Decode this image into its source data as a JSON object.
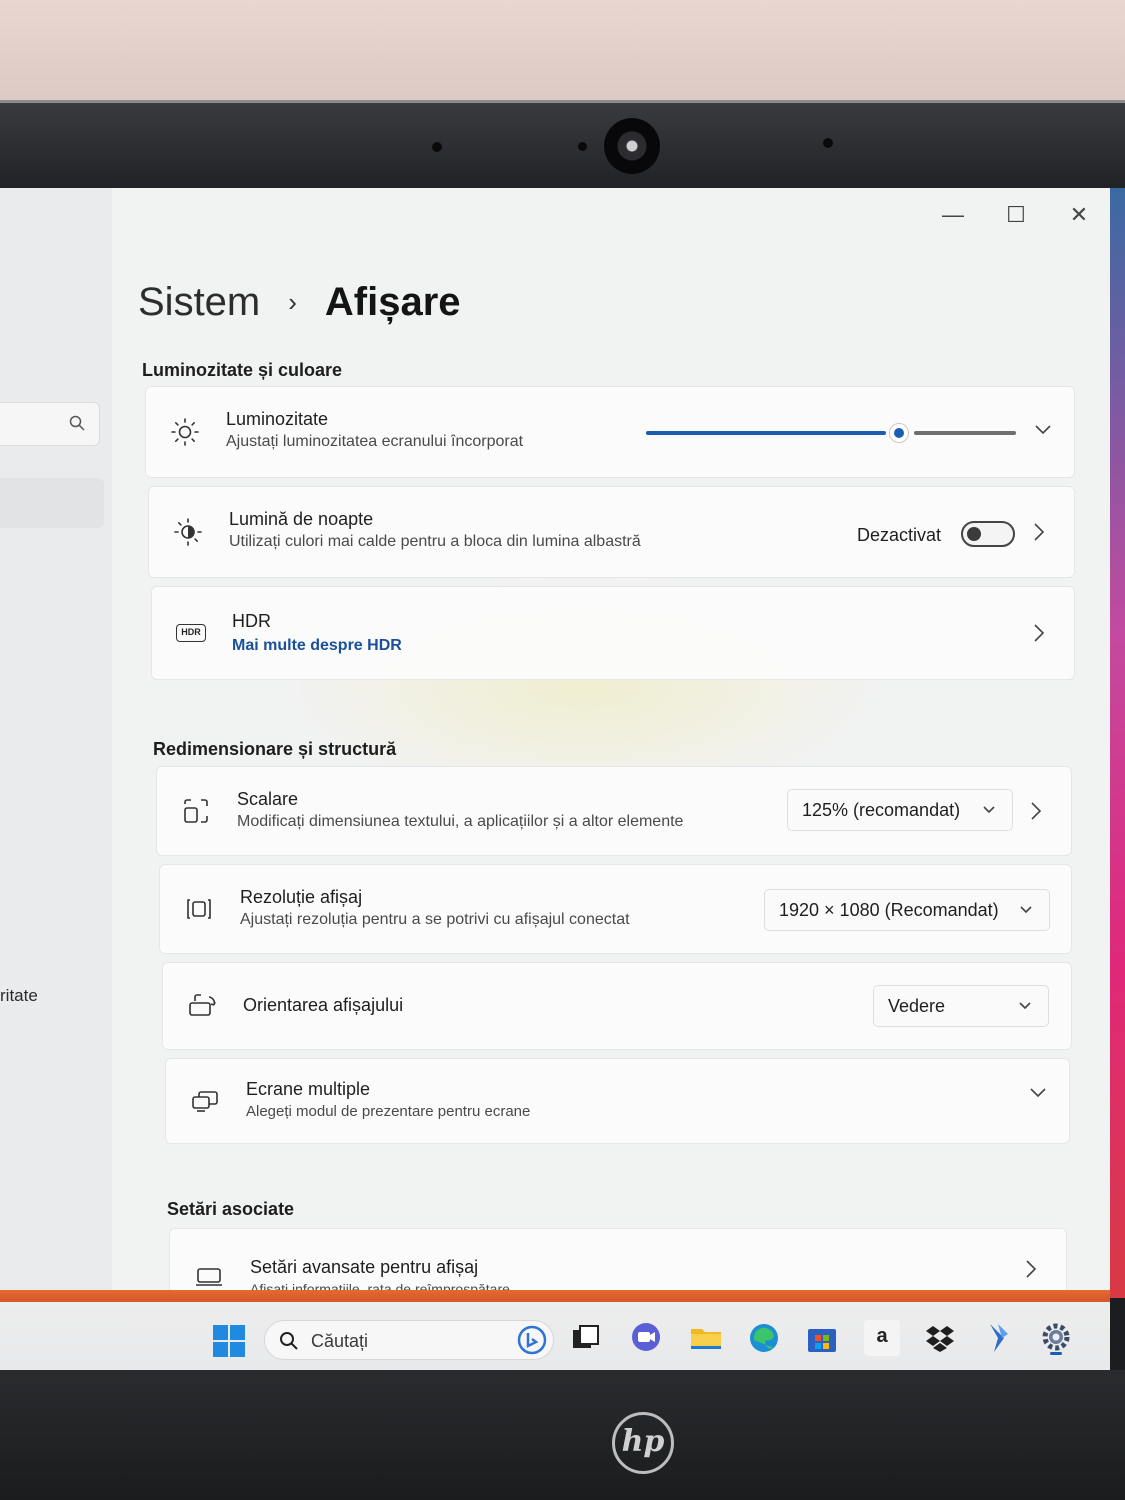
{
  "window": {
    "minimize_glyph": "—",
    "maximize_glyph": "☐",
    "close_glyph": "✕"
  },
  "breadcrumb": {
    "parent": "Sistem",
    "separator": "›",
    "current": "Afișare"
  },
  "sidebar": {
    "partial_item_text": "ritate"
  },
  "sections": {
    "brightness_color": "Luminozitate și culoare",
    "scale_layout": "Redimensionare și structură",
    "related": "Setări asociate"
  },
  "brightness": {
    "title": "Luminozitate",
    "subtitle": "Ajustați luminozitatea ecranului încorporat",
    "level_percent": 67
  },
  "night_light": {
    "title": "Lumină de noapte",
    "subtitle": "Utilizați culori mai calde pentru a bloca din lumina albastră",
    "state_label": "Dezactivat",
    "enabled": false
  },
  "hdr": {
    "title": "HDR",
    "link": "Mai multe despre HDR",
    "icon_text": "HDR"
  },
  "scale": {
    "title": "Scalare",
    "subtitle": "Modificați dimensiunea textului, a aplicațiilor și a altor elemente",
    "value": "125% (recomandat)"
  },
  "resolution": {
    "title": "Rezoluție afișaj",
    "subtitle": "Ajustați rezoluția pentru a se  potrivi cu afișajul conectat",
    "value": "1920 × 1080 (Recomandat)"
  },
  "orientation": {
    "title": "Orientarea afișajului",
    "value": "Vedere"
  },
  "multiple_displays": {
    "title": "Ecrane multiple",
    "subtitle": "Alegeți modul de prezentare pentru ecrane"
  },
  "advanced_display": {
    "title": "Setări avansate pentru afișaj",
    "subtitle": "Afișați informațiile, rata de reîmprospătare"
  },
  "taskbar": {
    "search_label": "Căutați",
    "amazon_letter": "a"
  },
  "colors": {
    "accent": "#1c5db3",
    "link": "#1a4f9a"
  },
  "device": {
    "logo": "hp"
  }
}
